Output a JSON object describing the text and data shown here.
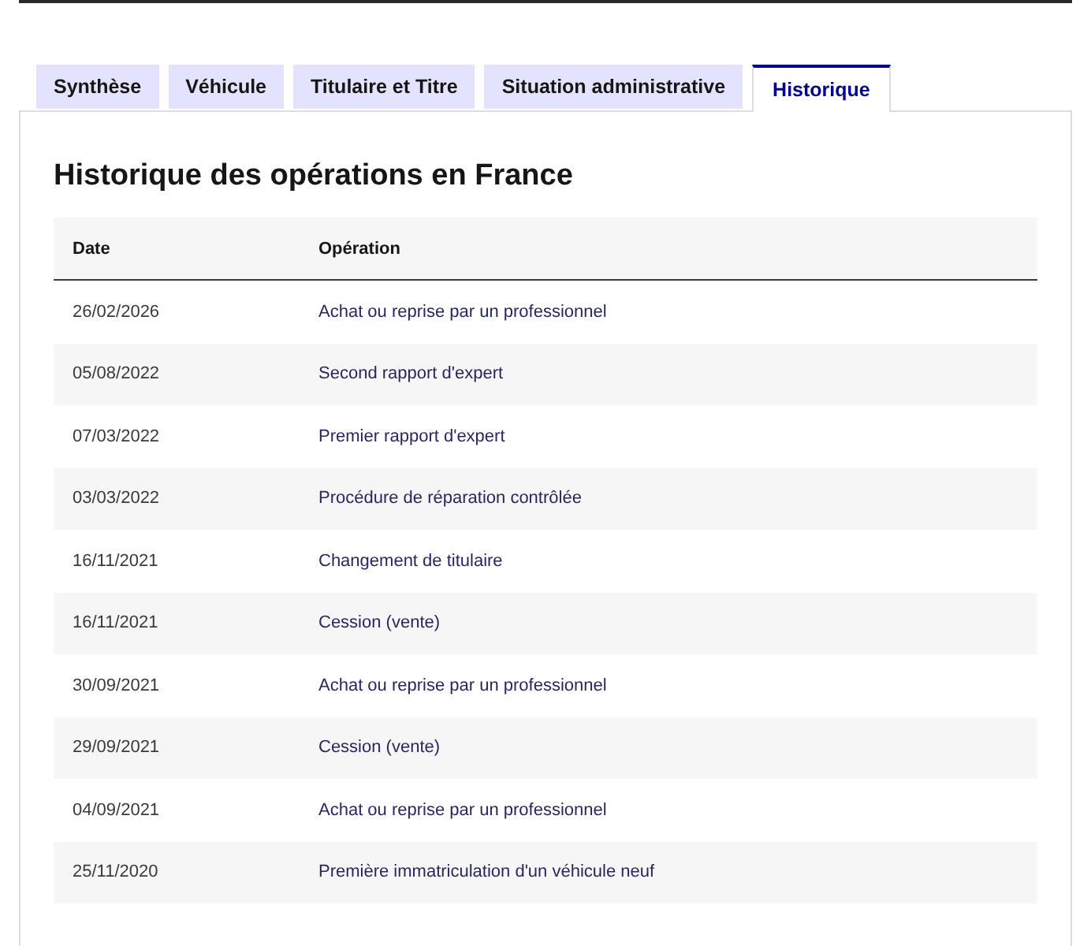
{
  "tabs": [
    {
      "label": "Synthèse",
      "selected": false
    },
    {
      "label": "Véhicule",
      "selected": false
    },
    {
      "label": "Titulaire et Titre",
      "selected": false
    },
    {
      "label": "Situation administrative",
      "selected": false
    },
    {
      "label": "Historique",
      "selected": true
    }
  ],
  "panel": {
    "title": "Historique des opérations en France",
    "table": {
      "columns": [
        "Date",
        "Opération"
      ],
      "rows": [
        {
          "date": "26/02/2026",
          "operation": "Achat ou reprise par un professionnel"
        },
        {
          "date": "05/08/2022",
          "operation": "Second rapport d'expert"
        },
        {
          "date": "07/03/2022",
          "operation": "Premier rapport d'expert"
        },
        {
          "date": "03/03/2022",
          "operation": "Procédure de réparation contrôlée"
        },
        {
          "date": "16/11/2021",
          "operation": "Changement de titulaire"
        },
        {
          "date": "16/11/2021",
          "operation": "Cession (vente)"
        },
        {
          "date": "30/09/2021",
          "operation": "Achat ou reprise par un professionnel"
        },
        {
          "date": "29/09/2021",
          "operation": "Cession (vente)"
        },
        {
          "date": "04/09/2021",
          "operation": "Achat ou reprise par un professionnel"
        },
        {
          "date": "25/11/2020",
          "operation": "Première immatriculation d'un véhicule neuf"
        }
      ]
    }
  }
}
